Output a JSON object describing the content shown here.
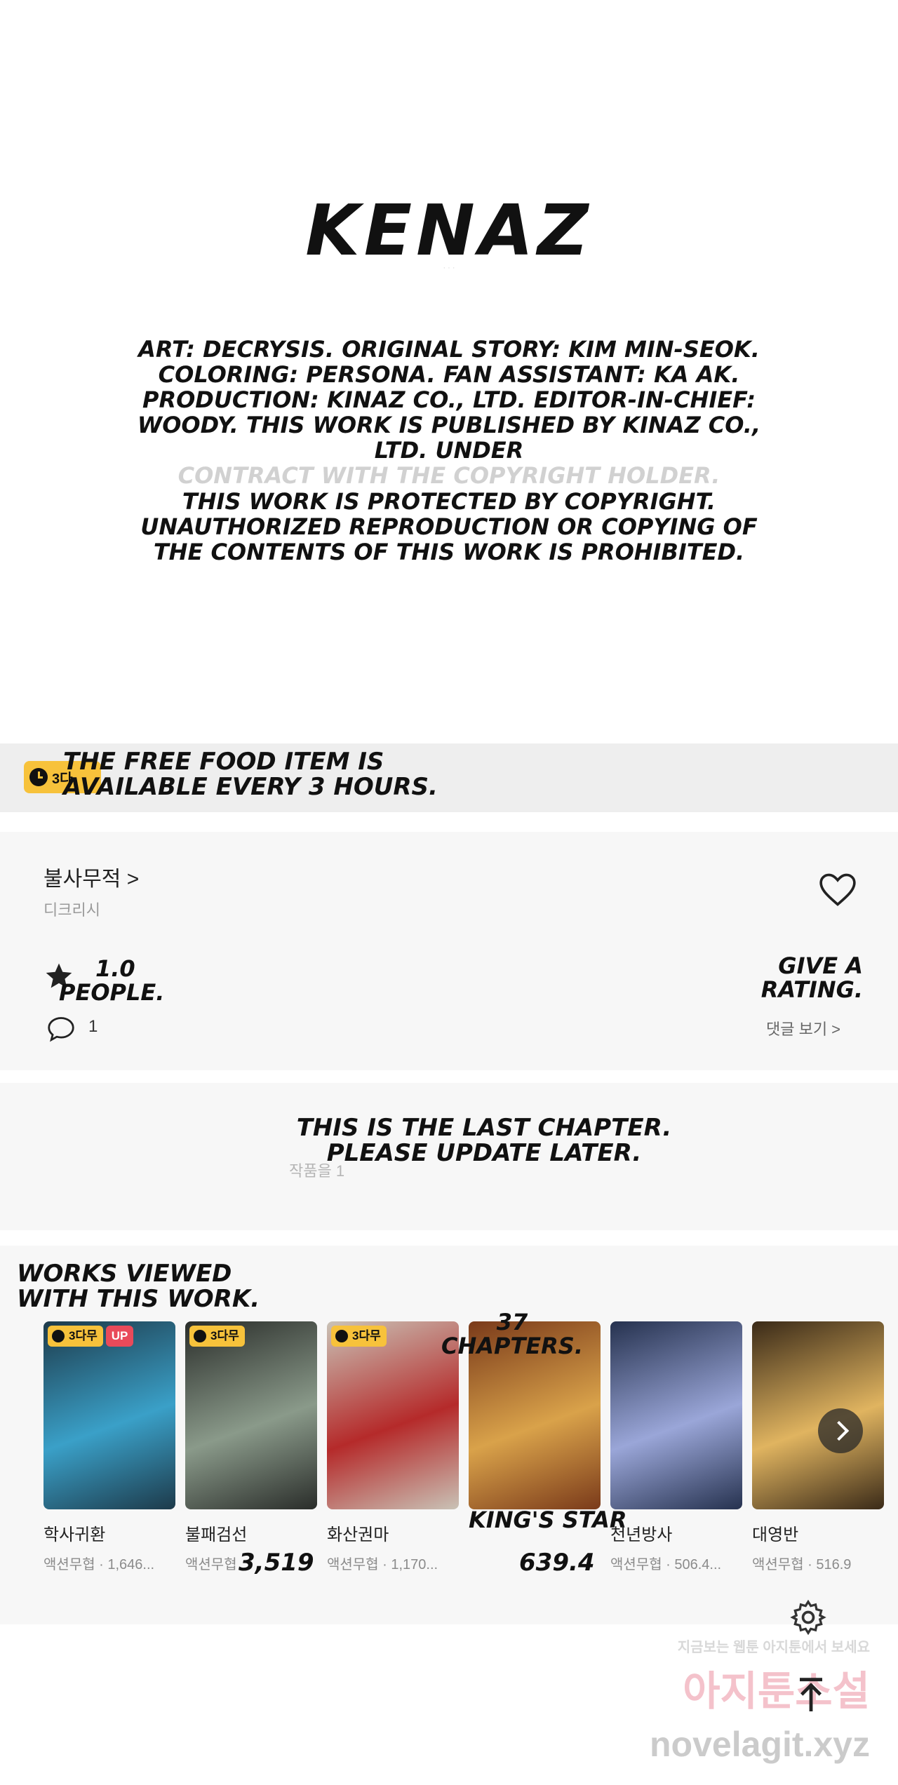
{
  "credits": {
    "logo": "KENAZ",
    "logo_sub": "· ·  ·",
    "text": "ART: DECRYSIS. ORIGINAL STORY: KIM MIN-SEOK. COLORING: PERSONA. FAN ASSISTANT: KA AK. PRODUCTION: KINAZ CO., LTD. EDITOR-IN-CHIEF: WOODY. THIS WORK IS PUBLISHED BY KINAZ CO., LTD. UNDER",
    "ghost_text": "CONTRACT WITH THE COPYRIGHT HOLDER.",
    "protection_text": "THIS WORK IS PROTECTED BY COPYRIGHT. UNAUTHORIZED REPRODUCTION OR COPYING OF THE CONTENTS OF THIS WORK IS PROHIBITED."
  },
  "free_banner": {
    "badge": "3다",
    "text": "THE FREE FOOD ITEM IS AVAILABLE EVERY 3 HOURS."
  },
  "work": {
    "title": "불사무적 >",
    "author": "디크리시",
    "rating_value": "1.0",
    "rating_people": "PEOPLE.",
    "give_rating": "GIVE A RATING.",
    "comment_count": "1",
    "comment_link": "댓글 보기 >"
  },
  "last_chapter": {
    "sub": "작품을 1",
    "text": "THIS IS THE LAST CHAPTER. PLEASE UPDATE LATER."
  },
  "recommendations": {
    "title": "WORKS VIEWED WITH THIS WORK.",
    "items": [
      {
        "name": "학사귀환",
        "meta": "액션무협 · 1,646...",
        "badge": "3다무",
        "up": "UP",
        "color_a": "#1d3a4a",
        "color_b": "#3aa0c8"
      },
      {
        "name": "불패검선",
        "meta": "액션무협",
        "badge": "3다무",
        "up": "",
        "color_a": "#2a2d2a",
        "color_b": "#8a9a8a"
      },
      {
        "name": "화산권마",
        "meta": "액션무협 · 1,170...",
        "badge": "3다무",
        "up": "",
        "color_a": "#c9c2b6",
        "color_b": "#b52a2a"
      },
      {
        "name": "",
        "meta": "",
        "badge": "",
        "up": "",
        "color_a": "#7a3a1a",
        "color_b": "#d9a24a"
      },
      {
        "name": "천년방사",
        "meta": "액션무협 · 506.4...",
        "badge": "",
        "up": "",
        "color_a": "#26324f",
        "color_b": "#9aa6d8"
      },
      {
        "name": "대영반",
        "meta": "액션무협 · 516.9",
        "badge": "",
        "up": "",
        "color_a": "#3a2a18",
        "color_b": "#e0b460"
      }
    ],
    "chapters_overlay": "37 CHAPTERS.",
    "kings_star": "KING'S STAR",
    "num_a": "3,519",
    "num_b": "639.4"
  },
  "watermark": {
    "top": "지금보는 웹툰 아지툰에서 보세요",
    "mid": "아지툰소설",
    "url": "novelagit.xyz"
  }
}
